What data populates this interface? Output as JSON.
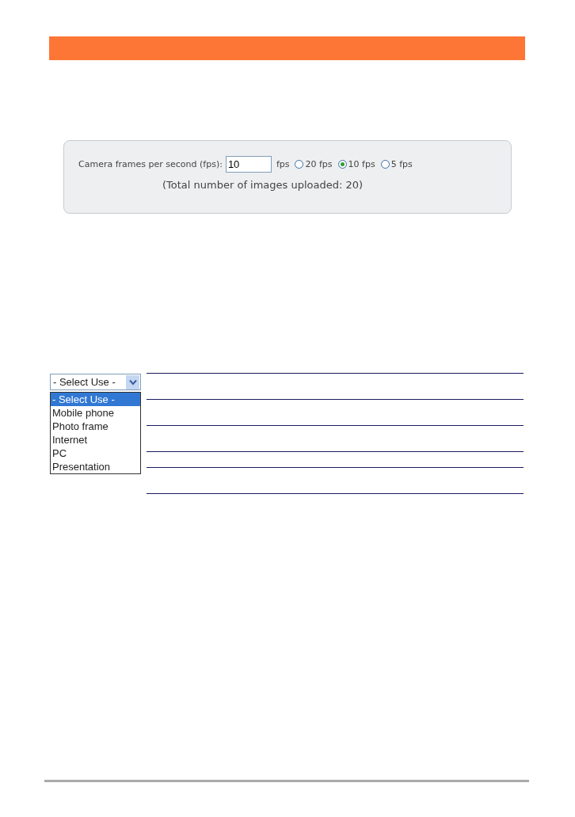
{
  "fps_panel": {
    "label": "Camera frames per second (fps):",
    "value": "10",
    "unit": "fps",
    "options": [
      {
        "label": "20 fps",
        "selected": false
      },
      {
        "label": "10 fps",
        "selected": true
      },
      {
        "label": "5 fps",
        "selected": false
      }
    ],
    "note": "(Total number of images uploaded: 20)"
  },
  "use_select": {
    "value": "- Select Use -",
    "options": [
      {
        "label": "- Select Use -",
        "selected": true
      },
      {
        "label": "Mobile phone",
        "selected": false
      },
      {
        "label": "Photo frame",
        "selected": false
      },
      {
        "label": "Internet",
        "selected": false
      },
      {
        "label": "PC",
        "selected": false
      },
      {
        "label": "Presentation",
        "selected": false
      }
    ]
  }
}
